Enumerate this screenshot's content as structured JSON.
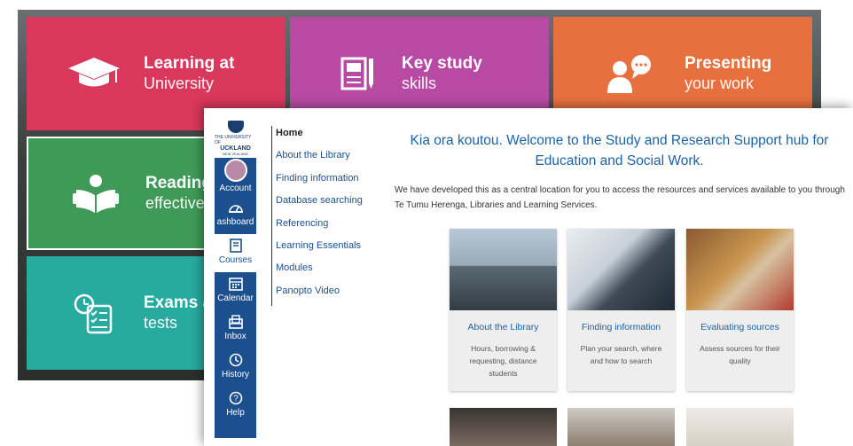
{
  "back_tiles": {
    "learning": {
      "title": "Learning at",
      "subtitle": "University",
      "icon": "graduation-cap-icon",
      "color": "#d9375b"
    },
    "keystudy": {
      "title": "Key study",
      "subtitle": "skills",
      "icon": "notebook-pen-icon",
      "color": "#b84aa4"
    },
    "presenting": {
      "title": "Presenting",
      "subtitle": "your work",
      "icon": "person-speech-icon",
      "color": "#e8703f"
    },
    "reading": {
      "title": "Reading",
      "subtitle": "effectively",
      "icon": "reader-book-icon",
      "color": "#3f9a58"
    },
    "exams": {
      "title": "Exams a",
      "subtitle": "tests",
      "icon": "timer-checklist-icon",
      "color": "#27aaa0"
    }
  },
  "global_nav": {
    "logo": {
      "line1": "THE UNIVERSITY OF",
      "line2": "UCKLAND",
      "line3": "NEW ZEALAND"
    },
    "items": [
      {
        "label": "Account",
        "icon": "avatar-icon"
      },
      {
        "label": "ashboard",
        "icon": "dashboard-icon"
      },
      {
        "label": "Courses",
        "icon": "book-icon"
      },
      {
        "label": "Calendar",
        "icon": "calendar-icon"
      },
      {
        "label": "Inbox",
        "icon": "inbox-icon"
      },
      {
        "label": "History",
        "icon": "clock-icon"
      },
      {
        "label": "Help",
        "icon": "question-icon"
      }
    ],
    "colors": {
      "primary": "#1b4f8e"
    }
  },
  "course_nav": [
    "Home",
    "About the Library",
    "Finding information",
    "Database searching",
    "Referencing",
    "Learning Essentials",
    "Modules",
    "Panopto Video"
  ],
  "main": {
    "title": "Kia ora koutou.  Welcome to the Study and Research Support hub for Education and Social Work.",
    "intro": "We have developed this as a central location for you to access the resources and services available to you through Te Tumu Herenga,  Libraries and Learning Services.",
    "cards": [
      {
        "title": "About the Library",
        "desc": "Hours,  borrowing & requesting,  distance students"
      },
      {
        "title": "Finding information",
        "desc": "Plan your search, where and how to search"
      },
      {
        "title": "Evaluating sources",
        "desc": "Assess sources for their quality"
      }
    ]
  }
}
